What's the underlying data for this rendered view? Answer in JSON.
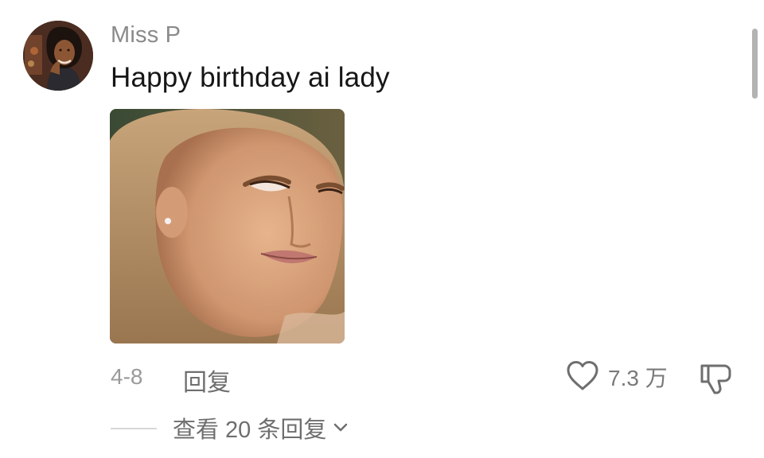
{
  "comment": {
    "username": "Miss P",
    "text": "Happy birthday ai lady",
    "date": "4-8",
    "reply_label": "回复",
    "like_count": "7.3 万",
    "view_replies_label": "查看 20 条回复"
  },
  "icons": {
    "like": "heart-outline-icon",
    "dislike": "thumbs-down-outline-icon",
    "expand": "chevron-down-icon"
  },
  "colors": {
    "username": "#8a8a8a",
    "text": "#161616",
    "meta": "#9a9a9a",
    "action": "#6e6e6e"
  }
}
